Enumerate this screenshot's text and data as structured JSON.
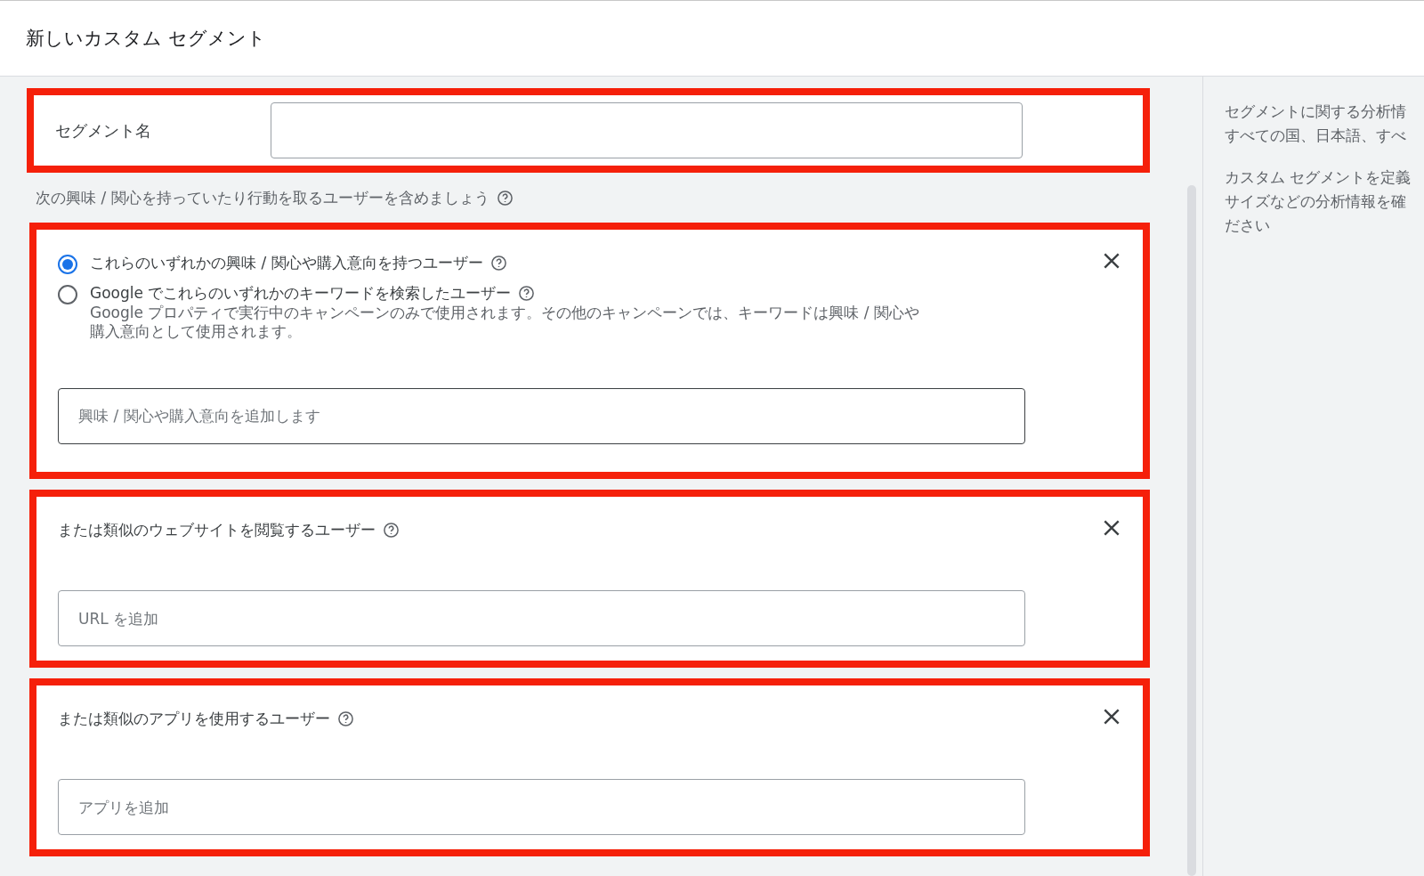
{
  "header": {
    "title": "新しいカスタム セグメント"
  },
  "segment_name": {
    "label": "セグメント名"
  },
  "include_hint": "次の興味 / 関心を持っていたり行動を取るユーザーを含めましょう",
  "sections": [
    {
      "kind": "choice",
      "options": [
        {
          "label": "これらのいずれかの興味 / 関心や購入意向を持つユーザー",
          "selected": true
        },
        {
          "label": "Google でこれらのいずれかのキーワードを検索したユーザー",
          "selected": false,
          "description_lines": [
            "Google プロパティで実行中のキャンペーンのみで使用されます。その他のキャンペーンでは、キーワードは興味 / 関心や",
            "購入意向として使用されます。"
          ]
        }
      ],
      "placeholder": "興味 / 関心や購入意向を追加します"
    },
    {
      "kind": "plain",
      "title": "または類似のウェブサイトを閲覧するユーザー",
      "placeholder": "URL を追加"
    },
    {
      "kind": "plain",
      "title": "または類似のアプリを使用するユーザー",
      "placeholder": "アプリを追加"
    }
  ],
  "side_panel": {
    "paragraphs": [
      [
        "セグメントに関する分析情",
        "すべての国、日本語、すべ"
      ],
      [
        "カスタム セグメントを定義",
        "サイズなどの分析情報を確",
        "ださい"
      ]
    ]
  }
}
